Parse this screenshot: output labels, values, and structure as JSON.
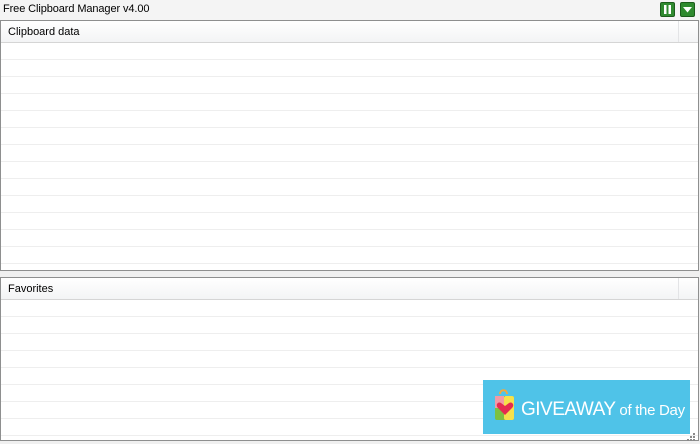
{
  "window": {
    "title": "Free Clipboard Manager v4.00"
  },
  "titlebar_buttons": {
    "pause_icon": "pause-icon",
    "menu_icon": "chevron-down-icon",
    "color": "#2f8a2f"
  },
  "clipboard_panel": {
    "column_header": "Clipboard data",
    "rows": []
  },
  "favorites_panel": {
    "column_header": "Favorites",
    "rows": []
  },
  "banner": {
    "main_text": "GIVEAWAY",
    "sub_text": " of the Day",
    "background": "#4fc3e8"
  }
}
